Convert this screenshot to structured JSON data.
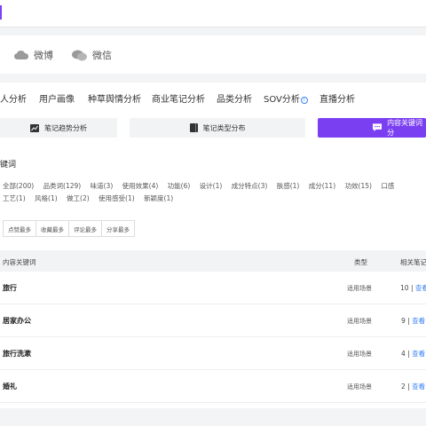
{
  "platforms": [
    {
      "icon": "cloud-icon",
      "label": "微博"
    },
    {
      "icon": "chat-icon",
      "label": "微信"
    }
  ],
  "tabs": [
    {
      "label": "人分析"
    },
    {
      "label": "用户画像"
    },
    {
      "label": "种草舆情分析"
    },
    {
      "label": "商业笔记分析"
    },
    {
      "label": "品类分析"
    },
    {
      "label": "SOV分析"
    },
    {
      "label": "直播分析"
    }
  ],
  "sov_info_icon": "i",
  "subtabs": [
    {
      "label": "笔记趋势分析",
      "icon": "trend-chart-icon"
    },
    {
      "label": "笔记类型分布",
      "icon": "book-icon"
    },
    {
      "label": "内容关键词分",
      "icon": "comment-icon",
      "active": true
    }
  ],
  "section_title": "键词",
  "filters": [
    "全部(200)",
    "品类词(129)",
    "味道(3)",
    "使用效果(4)",
    "功能(6)",
    "设计(1)",
    "成分特点(3)",
    "肤感(1)",
    "成分(11)",
    "功效(15)",
    "口感",
    "工艺(1)",
    "风格(1)",
    "做工(2)",
    "使用感受(1)",
    "新颖度(1)"
  ],
  "sort_buttons": [
    "点赞最多",
    "收藏最多",
    "评论最多",
    "分享最多"
  ],
  "table": {
    "headers": {
      "keyword": "内容关键词",
      "type": "类型",
      "count": "相关笔记"
    },
    "rows": [
      {
        "keyword": "旅行",
        "type": "适用场景",
        "count": "10",
        "view": "查看"
      },
      {
        "keyword": "居家办公",
        "type": "适用场景",
        "count": "9",
        "view": "查看"
      },
      {
        "keyword": "旅行洗漱",
        "type": "适用场景",
        "count": "4",
        "view": "查看"
      },
      {
        "keyword": "婚礼",
        "type": "适用场景",
        "count": "2",
        "view": "查看"
      }
    ],
    "separator": "|"
  },
  "colors": {
    "accent": "#7b3ff2",
    "link": "#3b82f6"
  }
}
